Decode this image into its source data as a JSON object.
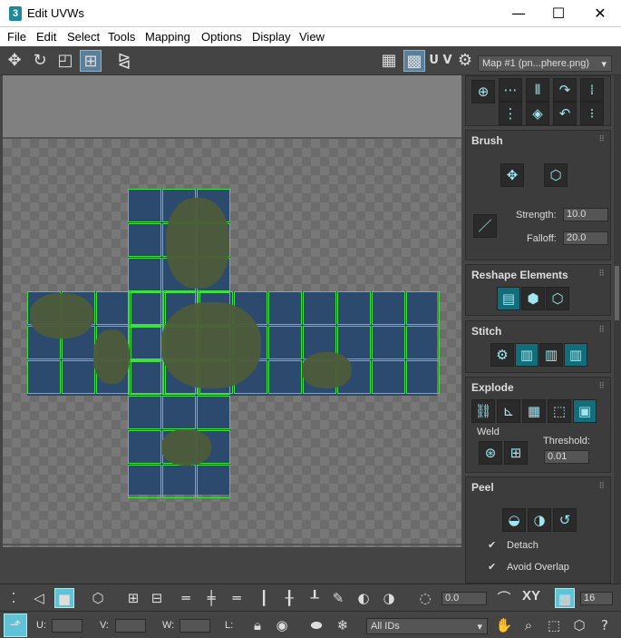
{
  "window": {
    "title": "Edit UVWs",
    "app_icon": "3",
    "minimize": "—",
    "maximize": "☐",
    "close": "✕"
  },
  "menu": [
    "File",
    "Edit",
    "Select",
    "Tools",
    "Mapping",
    "Options",
    "Display",
    "View"
  ],
  "toolbar": {
    "uv_label": "U V",
    "map_dropdown": "Map #1 (pn...phere.png)"
  },
  "panel": {
    "brush": {
      "title": "Brush",
      "strength_label": "Strength:",
      "strength_value": "10.0",
      "falloff_label": "Falloff:",
      "falloff_value": "20.0"
    },
    "reshape": {
      "title": "Reshape Elements"
    },
    "stitch": {
      "title": "Stitch"
    },
    "explode": {
      "title": "Explode",
      "weld_label": "Weld",
      "threshold_label": "Threshold:",
      "threshold_value": "0.01"
    },
    "peel": {
      "title": "Peel",
      "detach_label": "Detach",
      "avoid_overlap_label": "Avoid Overlap"
    }
  },
  "bottom": {
    "angle_value": "0.0",
    "xy_label": "XY",
    "grid_value": "16"
  },
  "status": {
    "u_label": "U:",
    "v_label": "V:",
    "w_label": "W:",
    "l_label": "L:",
    "ids_dropdown": "All IDs"
  },
  "colors": {
    "accent": "#5fc2d6",
    "uv_edges": "#3ce040",
    "panel_bg": "#444444"
  }
}
